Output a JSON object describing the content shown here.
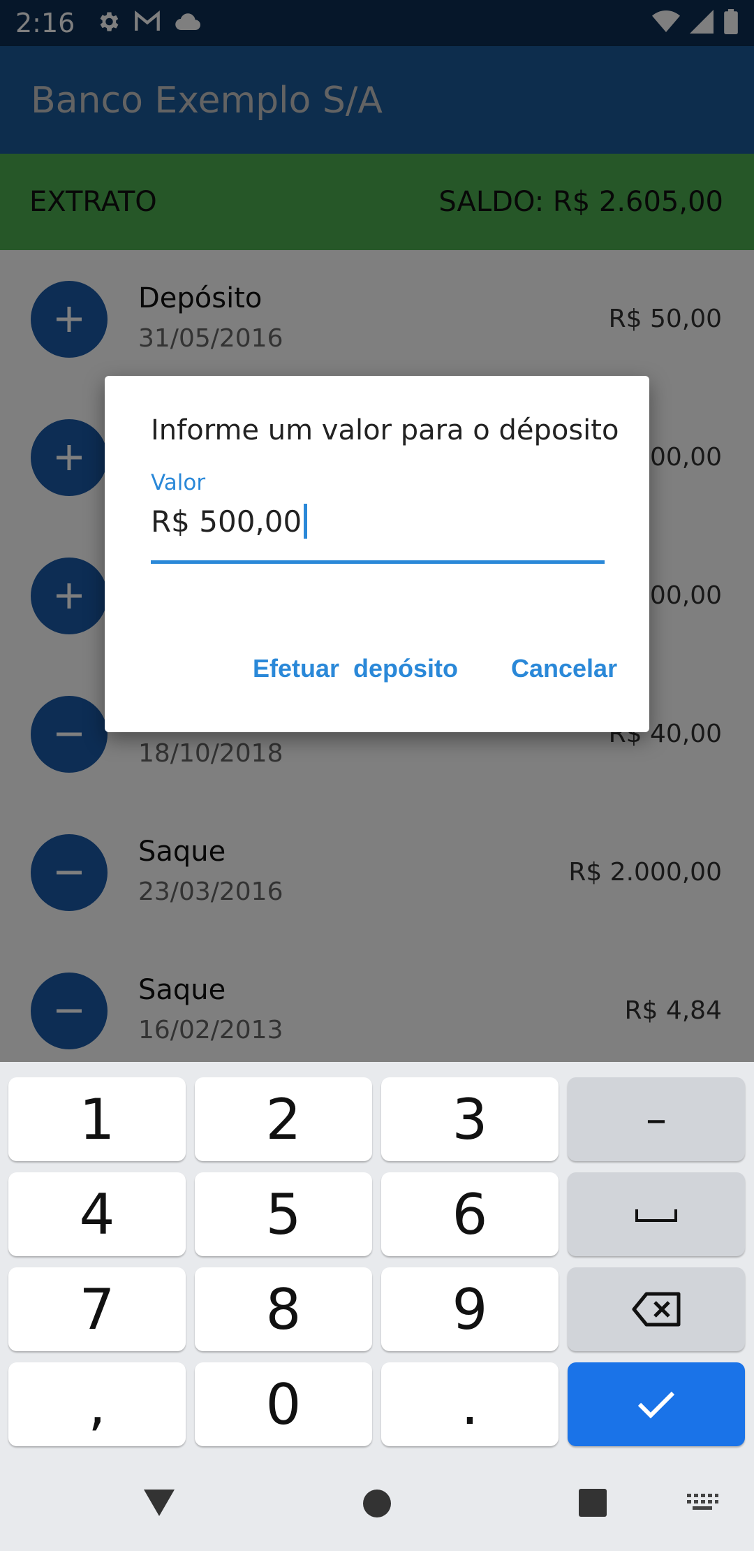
{
  "status_bar": {
    "time": "2:16",
    "icons": [
      "settings-icon",
      "gmail-icon",
      "cloud-icon",
      "wifi-icon",
      "signal-icon",
      "battery-icon"
    ]
  },
  "app_bar": {
    "title": "Banco Exemplo S/A"
  },
  "summary": {
    "left": "EXTRATO",
    "right": "SALDO: R$ 2.605,00"
  },
  "transactions": [
    {
      "type": "plus",
      "title": "Depósito",
      "date": "31/05/2016",
      "amount": "R$ 50,00"
    },
    {
      "type": "plus",
      "title": "",
      "date": "",
      "amount": "00,00"
    },
    {
      "type": "plus",
      "title": "",
      "date": "",
      "amount": "000,00"
    },
    {
      "type": "minus",
      "title": "",
      "date": "18/10/2018",
      "amount": "R$ 40,00"
    },
    {
      "type": "minus",
      "title": "Saque",
      "date": "23/03/2016",
      "amount": "R$ 2.000,00"
    },
    {
      "type": "minus",
      "title": "Saque",
      "date": "16/02/2013",
      "amount": "R$ 4,84"
    }
  ],
  "dialog": {
    "title": "Informe um valor para o déposito",
    "field_label": "Valor",
    "field_value": "R$ 500,00",
    "confirm_label": "Efetuar  depósito",
    "cancel_label": "Cancelar"
  },
  "keyboard": {
    "rows": [
      [
        "1",
        "2",
        "3",
        "–"
      ],
      [
        "4",
        "5",
        "6",
        "space"
      ],
      [
        "7",
        "8",
        "9",
        "backspace"
      ],
      [
        ",",
        "0",
        ".",
        "enter"
      ]
    ]
  },
  "colors": {
    "status_bar": "#0d2f54",
    "app_bar": "#1a5a9a",
    "summary_bar": "#4caf50",
    "accent": "#2a88d8",
    "keyboard_enter": "#1a73e8"
  }
}
